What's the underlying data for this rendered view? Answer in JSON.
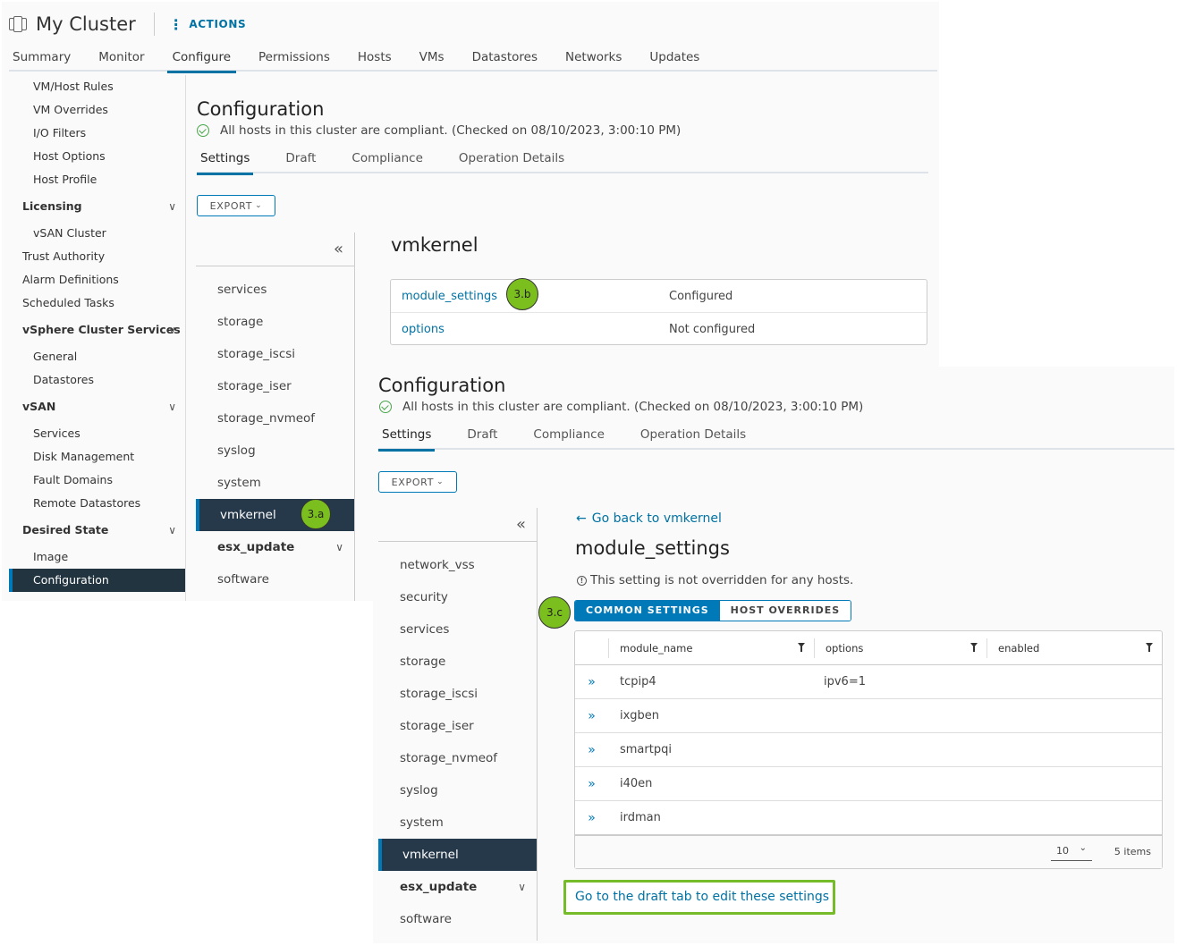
{
  "panel1": {
    "header": {
      "title": "My Cluster",
      "actions_label": "ACTIONS",
      "icon": "cluster-icon"
    },
    "top_tabs": [
      {
        "label": "Summary",
        "active": false
      },
      {
        "label": "Monitor",
        "active": false
      },
      {
        "label": "Configure",
        "active": true
      },
      {
        "label": "Permissions",
        "active": false
      },
      {
        "label": "Hosts",
        "active": false
      },
      {
        "label": "VMs",
        "active": false
      },
      {
        "label": "Datastores",
        "active": false
      },
      {
        "label": "Networks",
        "active": false
      },
      {
        "label": "Updates",
        "active": false
      }
    ],
    "left_nav": [
      {
        "label": "VM/Host Rules",
        "type": "child"
      },
      {
        "label": "VM Overrides",
        "type": "child"
      },
      {
        "label": "I/O Filters",
        "type": "child"
      },
      {
        "label": "Host Options",
        "type": "child"
      },
      {
        "label": "Host Profile",
        "type": "child"
      },
      {
        "label": "Licensing",
        "type": "group"
      },
      {
        "label": "vSAN Cluster",
        "type": "child"
      },
      {
        "label": "Trust Authority",
        "type": "top"
      },
      {
        "label": "Alarm Definitions",
        "type": "top"
      },
      {
        "label": "Scheduled Tasks",
        "type": "top"
      },
      {
        "label": "vSphere Cluster Services",
        "type": "group"
      },
      {
        "label": "General",
        "type": "child"
      },
      {
        "label": "Datastores",
        "type": "child"
      },
      {
        "label": "vSAN",
        "type": "group"
      },
      {
        "label": "Services",
        "type": "child"
      },
      {
        "label": "Disk Management",
        "type": "child"
      },
      {
        "label": "Fault Domains",
        "type": "child"
      },
      {
        "label": "Remote Datastores",
        "type": "child"
      },
      {
        "label": "Desired State",
        "type": "group"
      },
      {
        "label": "Image",
        "type": "child"
      },
      {
        "label": "Configuration",
        "type": "active"
      }
    ],
    "config": {
      "title": "Configuration",
      "status": "All hosts in this cluster are compliant. (Checked on 08/10/2023, 3:00:10 PM)",
      "tabs": [
        "Settings",
        "Draft",
        "Compliance",
        "Operation Details"
      ],
      "export_label": "EXPORT"
    },
    "tree": [
      {
        "label": "services"
      },
      {
        "label": "storage"
      },
      {
        "label": "storage_iscsi"
      },
      {
        "label": "storage_iser"
      },
      {
        "label": "storage_nvmeof"
      },
      {
        "label": "syslog"
      },
      {
        "label": "system"
      },
      {
        "label": "vmkernel",
        "active": true
      },
      {
        "label": "esx_update",
        "bold": true
      },
      {
        "label": "software"
      }
    ],
    "vmkernel": {
      "title": "vmkernel",
      "rows": [
        {
          "name": "module_settings",
          "status": "Configured"
        },
        {
          "name": "options",
          "status": "Not configured"
        }
      ]
    },
    "badges": {
      "a": "3.a",
      "b": "3.b"
    }
  },
  "panel2": {
    "config": {
      "title": "Configuration",
      "status": "All hosts in this cluster are compliant. (Checked on 08/10/2023, 3:00:10 PM)",
      "tabs": [
        "Settings",
        "Draft",
        "Compliance",
        "Operation Details"
      ],
      "export_label": "EXPORT"
    },
    "tree": [
      {
        "label": "network_vss"
      },
      {
        "label": "security"
      },
      {
        "label": "services"
      },
      {
        "label": "storage"
      },
      {
        "label": "storage_iscsi"
      },
      {
        "label": "storage_iser"
      },
      {
        "label": "storage_nvmeof"
      },
      {
        "label": "syslog"
      },
      {
        "label": "system"
      },
      {
        "label": "vmkernel",
        "active": true
      },
      {
        "label": "esx_update",
        "bold": true
      },
      {
        "label": "software"
      }
    ],
    "back_link": "Go back to vmkernel",
    "title": "module_settings",
    "note": "This setting is not overridden for any hosts.",
    "segment": {
      "common": "COMMON SETTINGS",
      "overrides": "HOST OVERRIDES"
    },
    "grid": {
      "columns": [
        "module_name",
        "options",
        "enabled"
      ],
      "rows": [
        {
          "module_name": "tcpip4",
          "options": "ipv6=1",
          "enabled": ""
        },
        {
          "module_name": "ixgben",
          "options": "",
          "enabled": ""
        },
        {
          "module_name": "smartpqi",
          "options": "",
          "enabled": ""
        },
        {
          "module_name": "i40en",
          "options": "",
          "enabled": ""
        },
        {
          "module_name": "irdman",
          "options": "",
          "enabled": ""
        }
      ],
      "page_size": "10",
      "items_count": "5 items"
    },
    "draft_link": "Go to the draft tab to edit these settings",
    "badge_c": "3.c"
  },
  "colors": {
    "accent": "#0072a3",
    "selected_bg": "#22343f",
    "badge": "#7bbf1f",
    "highlight_border": "#76bc2a",
    "ok": "#4aa54a"
  }
}
